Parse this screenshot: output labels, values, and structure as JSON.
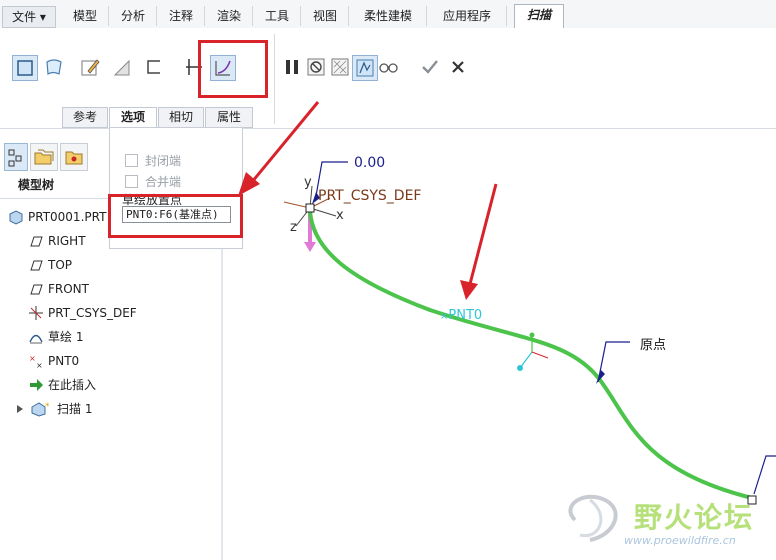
{
  "menu_tabs": [
    "文件 ▾",
    "模型",
    "分析",
    "注释",
    "渲染",
    "工具",
    "视图",
    "柔性建模",
    "应用程序",
    "扫描"
  ],
  "sub_tabs": [
    "参考",
    "选项",
    "相切",
    "属性"
  ],
  "options_panel": {
    "closed_ends_label": "封闭端",
    "merge_ends_label": "合并端",
    "sketch_origin_label": "草绘放置点",
    "sketch_origin_value": "PNT0:F6(基准点)"
  },
  "model_tree": {
    "title": "模型树",
    "items": [
      "PRT0001.PRT",
      "RIGHT",
      "TOP",
      "FRONT",
      "PRT_CSYS_DEF",
      "草绘 1",
      "PNT0",
      "在此插入",
      "扫描 1"
    ]
  },
  "viewport": {
    "dimension_value": "0.00",
    "csys_label": "PRT_CSYS_DEF",
    "axis_x": "x",
    "axis_y": "y",
    "axis_z": "z",
    "point_label": "PNT0",
    "origin_label": "原点"
  },
  "watermark": {
    "brand": "野火论坛",
    "url": "www.proewildfire.cn"
  },
  "colors": {
    "highlight_red": "#d8232a",
    "trajectory_green": "#4cc44c",
    "annotation_blue": "#1a1f8c",
    "point_cyan": "#2ec6d6"
  }
}
